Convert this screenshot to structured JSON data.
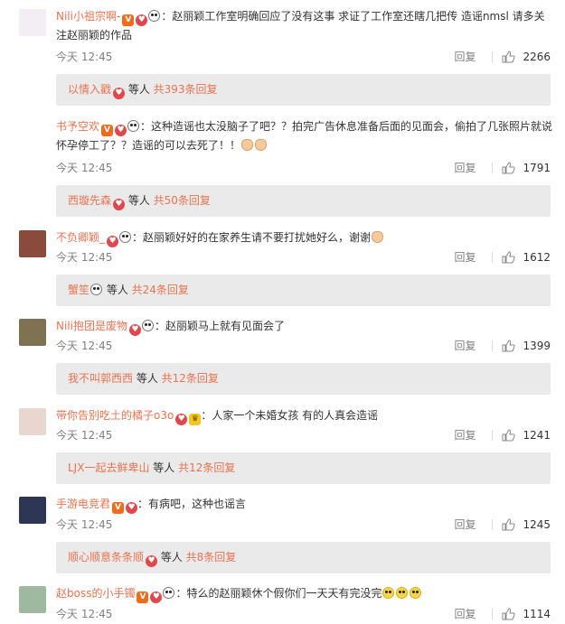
{
  "comments": [
    {
      "user": "Nili小祖宗啊-",
      "badges": [
        "v",
        "heart",
        "panda"
      ],
      "text": "：赵丽颖工作室明确回应了没有这事 求证了工作室还瞎几把传 造谣nmsl 请多关注赵丽颖的作品",
      "time": "今天 12:45",
      "reply_label": "回复",
      "likes": "2266",
      "sub_user": "以情入戳",
      "sub_badges": [
        "heart"
      ],
      "sub_mid": " 等人 ",
      "sub_count": "共393条回复",
      "avatar_color": "#f3eef4"
    },
    {
      "user": "书予空欢",
      "badges": [
        "v",
        "heart",
        "panda"
      ],
      "text": "：这种造谣也太没脑子了吧？？拍完广告休息准备后面的见面会，偷拍了几张照片就说怀孕停工了？？造谣的可以去死了！！",
      "emoji_tail": [
        "hand",
        "hand"
      ],
      "time": "今天 12:45",
      "reply_label": "回复",
      "likes": "1791",
      "sub_user": "西璇先森",
      "sub_badges": [
        "heart"
      ],
      "sub_mid": " 等人 ",
      "sub_count": "共50条回复",
      "avatar_color": "#ffffff"
    },
    {
      "user": "不负卿颖_",
      "badges": [
        "heart",
        "panda"
      ],
      "text": "：赵丽颖好好的在家养生请不要打扰她好么，谢谢",
      "emoji_tail": [
        "hand"
      ],
      "time": "今天 12:45",
      "reply_label": "回复",
      "likes": "1612",
      "sub_user": "蟹笙",
      "sub_badges": [
        "panda"
      ],
      "sub_mid": " 等人 ",
      "sub_count": "共24条回复",
      "avatar_color": "#8a4a3c"
    },
    {
      "user": "Nili抱团是废物",
      "badges": [
        "heart",
        "panda"
      ],
      "text": "：赵丽颖马上就有见面会了",
      "time": "今天 12:45",
      "reply_label": "回复",
      "likes": "1399",
      "sub_user": "我不叫郭西西",
      "sub_badges": [],
      "sub_mid": " 等人 ",
      "sub_count": "共12条回复",
      "avatar_color": "#7f7252"
    },
    {
      "user": "带你告别吃土的橘子o3o",
      "badges": [
        "heart",
        "crown"
      ],
      "text": "：人家一个未婚女孩 有的人真会造谣",
      "time": "今天 12:45",
      "reply_label": "回复",
      "likes": "1241",
      "sub_user": "LJX一起去鲜卑山",
      "sub_badges": [],
      "sub_mid": " 等人 ",
      "sub_count": "共12条回复",
      "avatar_color": "#e9d6cf"
    },
    {
      "user": "手游电竞君",
      "badges": [
        "v",
        "heart"
      ],
      "text": "：有病吧，这种也谣言",
      "time": "今天 12:45",
      "reply_label": "回复",
      "likes": "1245",
      "sub_user": "顺心顺意条条顺",
      "sub_badges": [
        "heart"
      ],
      "sub_mid": " 等人 ",
      "sub_count": "共8条回复",
      "avatar_color": "#2e3656"
    },
    {
      "user": "赵boss的小手镯",
      "badges": [
        "v",
        "heart",
        "panda"
      ],
      "text": "：特么的赵丽颖休个假你们一天天有完没完",
      "emoji_tail": [
        "smile",
        "smile",
        "smile"
      ],
      "time": "今天 12:45",
      "reply_label": "回复",
      "likes": "1114",
      "avatar_color": "#9fb9a0"
    }
  ],
  "colors": {
    "username": "#eb7350",
    "meta": "#808080",
    "subbox": "#eaeaea"
  }
}
